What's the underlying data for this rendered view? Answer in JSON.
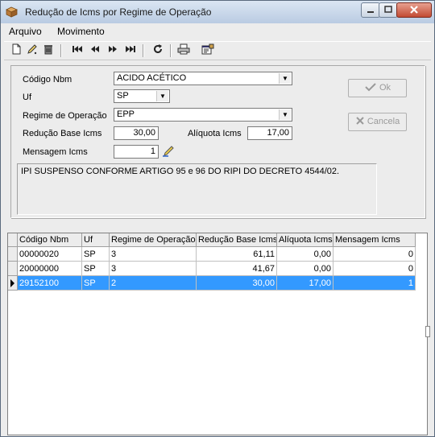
{
  "window": {
    "title": "Redução de Icms por Regime de Operação"
  },
  "menu": {
    "items": [
      "Arquivo",
      "Movimento"
    ]
  },
  "form": {
    "codigo_nbm": {
      "label": "Código Nbm",
      "value": "ACIDO ACÉTICO"
    },
    "uf": {
      "label": "Uf",
      "value": "SP"
    },
    "regime": {
      "label": "Regime de Operação",
      "value": "EPP"
    },
    "reducao": {
      "label": "Redução Base Icms",
      "value": "30,00"
    },
    "aliquota": {
      "label": "Alíquota Icms",
      "value": "17,00"
    },
    "mensagem": {
      "label": "Mensagem Icms",
      "value": "1"
    },
    "memo_text": "IPI SUSPENSO CONFORME ARTIGO 95 e 96 DO RIPI DO DECRETO 4544/02."
  },
  "buttons": {
    "ok": "Ok",
    "cancel": "Cancela"
  },
  "grid": {
    "columns": [
      "Código Nbm",
      "Uf",
      "Regime de Operação",
      "Redução Base Icms",
      "Alíquota Icms",
      "Mensagem Icms"
    ],
    "rows": [
      [
        "00000020",
        "SP",
        "3",
        "61,11",
        "0,00",
        "0"
      ],
      [
        "20000000",
        "SP",
        "3",
        "41,67",
        "0,00",
        "0"
      ],
      [
        "29152100",
        "SP",
        "2",
        "30,00",
        "17,00",
        "1"
      ]
    ],
    "selected_row": 2
  },
  "colors": {
    "selection": "#3399ff",
    "title_gradient_top": "#dbe6f3",
    "close_button": "#c24a33"
  }
}
